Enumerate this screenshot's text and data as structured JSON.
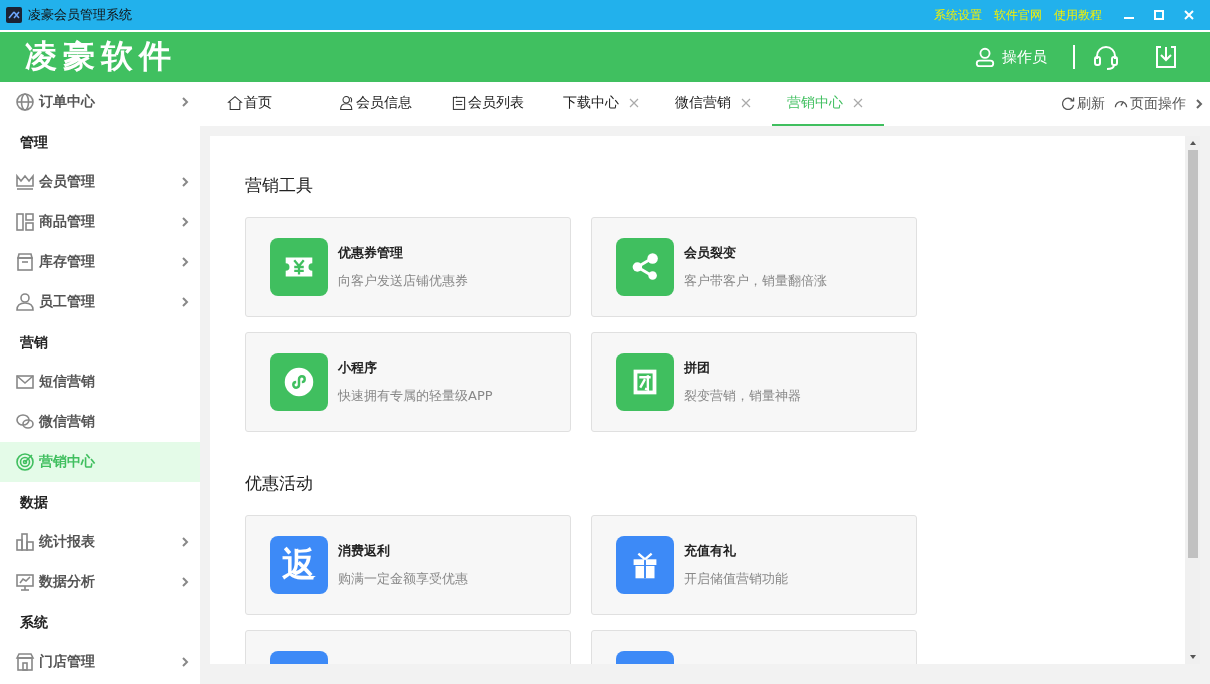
{
  "window": {
    "title": "凌豪会员管理系统",
    "links": [
      "系统设置",
      "软件官网",
      "使用教程"
    ]
  },
  "header": {
    "brand": "凌豪软件",
    "user": "操作员"
  },
  "sidebar": {
    "items": [
      {
        "kind": "item",
        "label": "订单中心",
        "arrow": true,
        "selected": false
      },
      {
        "kind": "header",
        "label": "管理"
      },
      {
        "kind": "item",
        "label": "会员管理",
        "arrow": true,
        "selected": false
      },
      {
        "kind": "item",
        "label": "商品管理",
        "arrow": true,
        "selected": false
      },
      {
        "kind": "item",
        "label": "库存管理",
        "arrow": true,
        "selected": false
      },
      {
        "kind": "item",
        "label": "员工管理",
        "arrow": true,
        "selected": false
      },
      {
        "kind": "header",
        "label": "营销"
      },
      {
        "kind": "item",
        "label": "短信营销",
        "arrow": false,
        "selected": false
      },
      {
        "kind": "item",
        "label": "微信营销",
        "arrow": false,
        "selected": false
      },
      {
        "kind": "item",
        "label": "营销中心",
        "arrow": false,
        "selected": true
      },
      {
        "kind": "header",
        "label": "数据"
      },
      {
        "kind": "item",
        "label": "统计报表",
        "arrow": true,
        "selected": false
      },
      {
        "kind": "item",
        "label": "数据分析",
        "arrow": true,
        "selected": false
      },
      {
        "kind": "header",
        "label": "系统"
      },
      {
        "kind": "item",
        "label": "门店管理",
        "arrow": true,
        "selected": false
      }
    ]
  },
  "tabs": [
    {
      "label": "首页",
      "closable": false,
      "selected": false
    },
    {
      "label": "会员信息",
      "closable": false,
      "selected": false
    },
    {
      "label": "会员列表",
      "closable": false,
      "selected": false
    },
    {
      "label": "下载中心",
      "closable": true,
      "selected": false
    },
    {
      "label": "微信营销",
      "closable": true,
      "selected": false
    },
    {
      "label": "营销中心",
      "closable": true,
      "selected": true
    }
  ],
  "tab_actions": [
    "刷新",
    "页面操作"
  ],
  "sections": [
    {
      "title": "营销工具",
      "cards": [
        {
          "color": "#40bf5f",
          "title": "优惠券管理",
          "desc": "向客户发送店铺优惠券"
        },
        {
          "color": "#40bf5f",
          "title": "会员裂变",
          "desc": "客户带客户，销量翻倍涨"
        },
        {
          "color": "#40bf5f",
          "title": "小程序",
          "desc": "快速拥有专属的轻量级APP"
        },
        {
          "color": "#40bf5f",
          "title": "拼团",
          "desc": "裂变营销，销量神器"
        }
      ]
    },
    {
      "title": "优惠活动",
      "cards": [
        {
          "glyph": "返",
          "color": "#3d8af7",
          "title": "消费返利",
          "desc": "购满一定金额享受优惠"
        },
        {
          "color": "#3d8af7",
          "title": "充值有礼",
          "desc": "开启储值营销功能"
        },
        {
          "color": "#3d8af7"
        },
        {
          "color": "#3d8af7"
        }
      ]
    }
  ]
}
